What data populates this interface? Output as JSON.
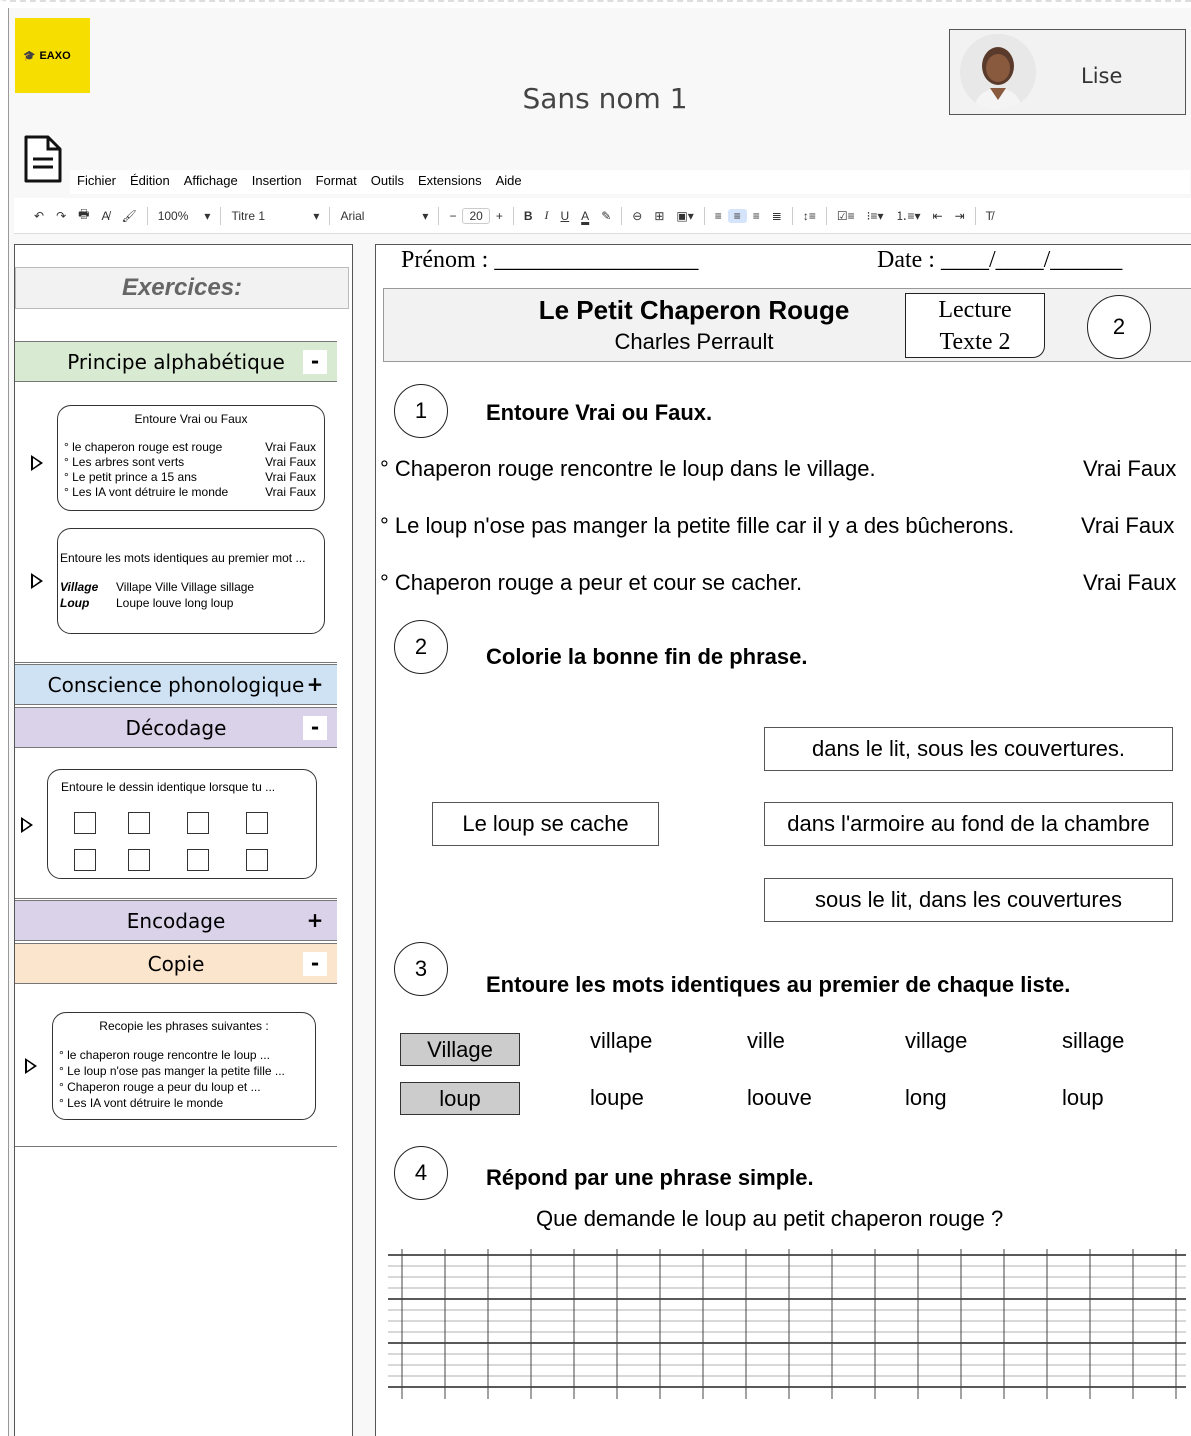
{
  "app": {
    "logo_text": "EAXO",
    "doc_title": "Sans nom 1",
    "user_name": "Lise"
  },
  "menu": [
    "Fichier",
    "Édition",
    "Affichage",
    "Insertion",
    "Format",
    "Outils",
    "Extensions",
    "Aide"
  ],
  "toolbar": {
    "zoom": "100%",
    "style": "Titre 1",
    "font": "Arial",
    "font_size": "20",
    "bold": "B",
    "italic": "I",
    "underline": "U",
    "text_color": "A"
  },
  "sidebar": {
    "title": "Exercices:",
    "sections": [
      {
        "label": "Principe alphabétique",
        "toggle": "-",
        "color": "#d9ead3"
      },
      {
        "label": "Conscience phonologique",
        "toggle": "+",
        "color": "#cfe2f3"
      },
      {
        "label": "Décodage",
        "toggle": "-",
        "color": "#d9d2e9"
      },
      {
        "label": "Encodage",
        "toggle": "+",
        "color": "#d9d2e9"
      },
      {
        "label": "Copie",
        "toggle": "-",
        "color": "#fce5cd"
      }
    ],
    "card_vf": {
      "title": "Entoure Vrai ou Faux",
      "lines": [
        {
          "text": "° le chaperon rouge est rouge",
          "choice": "Vrai Faux"
        },
        {
          "text": "° Les arbres sont verts",
          "choice": "Vrai Faux"
        },
        {
          "text": "° Le petit prince a 15 ans",
          "choice": "Vrai Faux"
        },
        {
          "text": "° Les IA vont détruire le monde",
          "choice": "Vrai Faux"
        }
      ]
    },
    "card_mots": {
      "title": "Entoure les mots identiques au premier mot ...",
      "rows": [
        {
          "head": "Village",
          "words": "Villape Ville Village  sillage"
        },
        {
          "head": "Loup",
          "words": "Loupe louve long loup"
        }
      ]
    },
    "card_dessin": {
      "title": "Entoure le dessin identique lorsque tu ..."
    },
    "card_copie": {
      "title": "Recopie les phrases suivantes :",
      "lines": [
        "° le chaperon rouge rencontre le loup ...",
        "° Le loup n'ose pas manger la petite fille ...",
        "° Chaperon rouge a peur du loup et ...",
        "° Les IA vont détruire le monde"
      ]
    }
  },
  "document": {
    "prenom_label": "Prénom : _________________",
    "date_label": "Date : ____/____/______",
    "story_title": "Le Petit Chaperon Rouge",
    "story_author": "Charles Perrault",
    "lecture_line1": "Lecture",
    "lecture_line2": "Texte 2",
    "text_number": "2",
    "q1": {
      "num": "1",
      "title": "Entoure Vrai ou Faux.",
      "statements": [
        "° Chaperon rouge rencontre le loup dans le village.",
        "° Le loup n'ose pas manger la petite fille car il y a des bûcherons.",
        "° Chaperon rouge a peur et cour se cacher."
      ],
      "choice": "Vrai Faux"
    },
    "q2": {
      "num": "2",
      "title": "Colorie la bonne fin de phrase.",
      "start": "Le loup se cache",
      "endings": [
        "dans le lit, sous les couvertures.",
        "dans l'armoire au fond de la chambre",
        "sous le lit, dans les couvertures"
      ]
    },
    "q3": {
      "num": "3",
      "title": "Entoure les mots identiques au premier de chaque liste.",
      "rows": [
        {
          "head": "Village",
          "words": [
            "villape",
            "ville",
            "village",
            "sillage"
          ]
        },
        {
          "head": "loup",
          "words": [
            "loupe",
            "loouve",
            "long",
            "loup"
          ]
        }
      ]
    },
    "q4": {
      "num": "4",
      "title": "Répond par une phrase simple.",
      "question": "Que demande le loup au petit chaperon rouge ?"
    }
  }
}
